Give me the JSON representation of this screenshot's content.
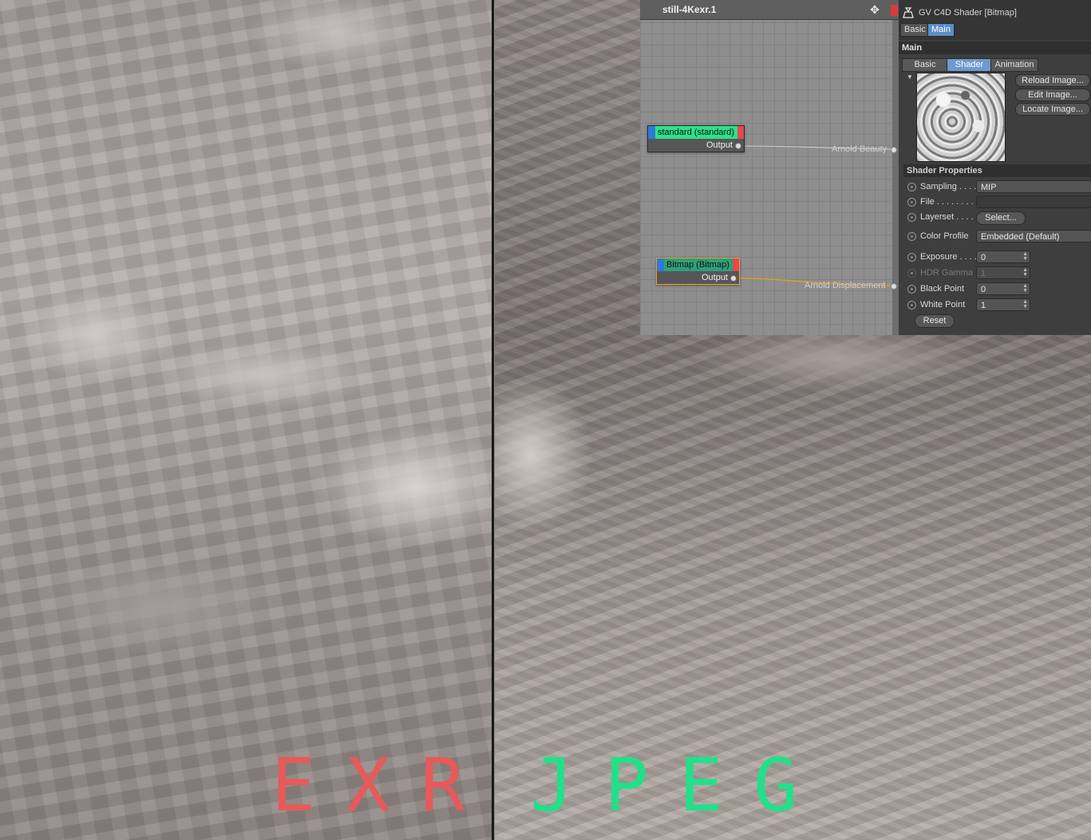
{
  "captions": {
    "left": "EXR",
    "right": "JPEG",
    "left_color": "#e65a5a",
    "right_color": "#22e08a"
  },
  "node_editor": {
    "title": "still-4Kexr.1",
    "icons": [
      "move-icon",
      "close-tab"
    ],
    "nodes": [
      {
        "title": "standard (standard)",
        "port": "Output",
        "header_color": "#2ee08a"
      },
      {
        "title": "Bitmap (Bitmap)",
        "port": "Output",
        "header_color": "#2fa07a"
      }
    ],
    "wires": [
      {
        "label": "Arnold Beauty",
        "color": "#c8c8c8"
      },
      {
        "label": "Arnold Displacement",
        "color": "#f0a020"
      }
    ]
  },
  "attributes": {
    "title": "GV C4D Shader [Bitmap]",
    "mode_tabs": [
      "Basic",
      "Main"
    ],
    "section_main": "Main",
    "sub_tabs": [
      "Basic",
      "Shader",
      "Animation"
    ],
    "buttons": [
      "Reload Image...",
      "Edit Image...",
      "Locate Image..."
    ],
    "section_shader_properties": "Shader Properties",
    "props": {
      "sampling": {
        "label": "Sampling . . . .",
        "value": "MIP"
      },
      "file": {
        "label": "File . . . . . . . . .",
        "value": ""
      },
      "layerset": {
        "label": "Layerset . . . .",
        "button": "Select..."
      },
      "color_profile": {
        "label": "Color Profile",
        "value": "Embedded (Default)"
      },
      "exposure": {
        "label": "Exposure . . . .",
        "value": "0"
      },
      "hdr_gamma": {
        "label": "HDR Gamma",
        "value": "1"
      },
      "black_point": {
        "label": "Black Point",
        "value": "0"
      },
      "white_point": {
        "label": "White Point",
        "value": "1"
      }
    },
    "reset": "Reset"
  }
}
